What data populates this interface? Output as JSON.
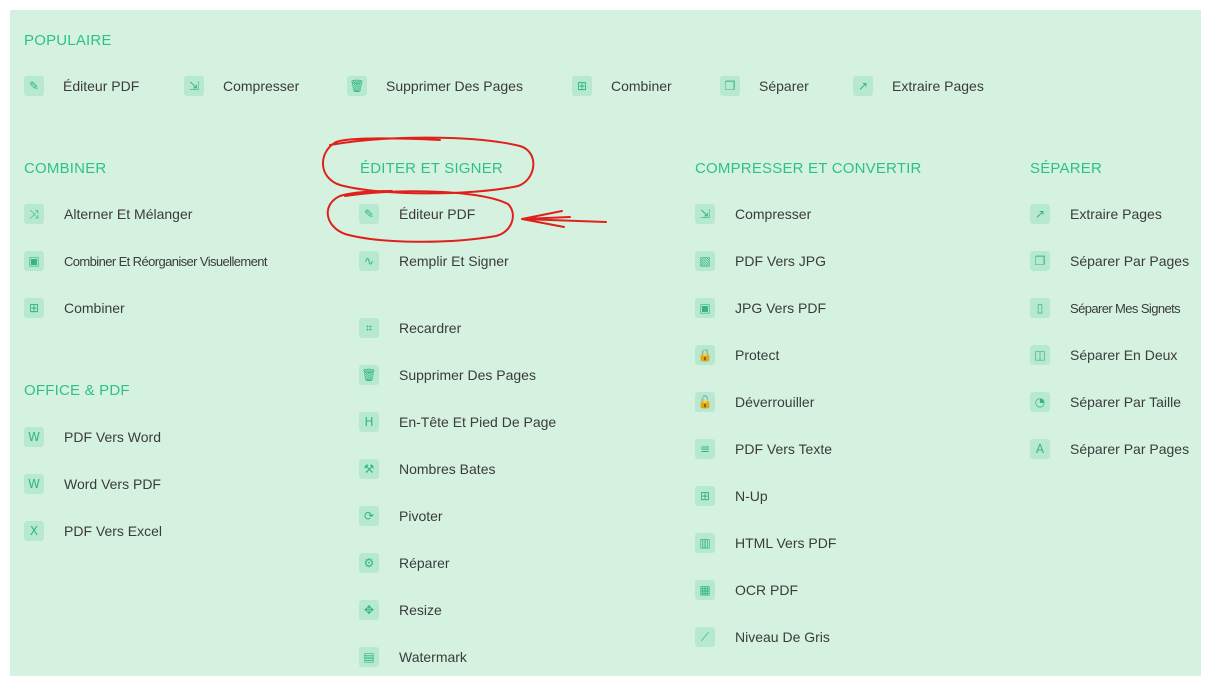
{
  "colors": {
    "panel_bg": "#d5f2e1",
    "accent": "#2fc08a",
    "icon_bg": "#b6e9cf",
    "annotation": "#e0201a"
  },
  "popular": {
    "heading": "POPULAIRE",
    "items": [
      {
        "label": "Éditeur PDF",
        "icon": "pencil-icon"
      },
      {
        "label": "Compresser",
        "icon": "compress-icon"
      },
      {
        "label": "Supprimer Des Pages",
        "icon": "trash-icon"
      },
      {
        "label": "Combiner",
        "icon": "sitemap-icon"
      },
      {
        "label": "Séparer",
        "icon": "copy-icon"
      },
      {
        "label": "Extraire Pages",
        "icon": "external-icon"
      }
    ]
  },
  "combine": {
    "heading": "COMBINER",
    "items": [
      {
        "label": "Alterner Et Mélanger",
        "icon": "shuffle-icon"
      },
      {
        "label": "Combiner Et Réorganiser Visuellement",
        "icon": "image-icon"
      },
      {
        "label": "Combiner",
        "icon": "sitemap-icon"
      }
    ]
  },
  "office": {
    "heading": "OFFICE & PDF",
    "items": [
      {
        "label": "PDF Vers Word",
        "icon": "word-file-icon"
      },
      {
        "label": "Word Vers PDF",
        "icon": "word-file-icon"
      },
      {
        "label": "PDF Vers Excel",
        "icon": "excel-file-icon"
      }
    ]
  },
  "edit": {
    "heading": "ÉDITER ET SIGNER",
    "items": [
      {
        "label": "Éditeur PDF",
        "icon": "pencil-icon"
      },
      {
        "label": "Remplir Et Signer",
        "icon": "signature-icon"
      },
      {
        "label": "Recardrer",
        "icon": "crop-icon"
      },
      {
        "label": "Supprimer Des Pages",
        "icon": "trash-icon"
      },
      {
        "label": "En-Tête Et Pied De Page",
        "icon": "header-icon"
      },
      {
        "label": "Nombres Bates",
        "icon": "stamp-icon"
      },
      {
        "label": "Pivoter",
        "icon": "rotate-icon"
      },
      {
        "label": "Réparer",
        "icon": "wrench-icon"
      },
      {
        "label": "Resize",
        "icon": "move-icon"
      },
      {
        "label": "Watermark",
        "icon": "file-icon"
      }
    ]
  },
  "compress": {
    "heading": "COMPRESSER ET CONVERTIR",
    "items": [
      {
        "label": "Compresser",
        "icon": "compress-icon"
      },
      {
        "label": "PDF Vers JPG",
        "icon": "image-file-icon"
      },
      {
        "label": "JPG Vers PDF",
        "icon": "image-icon"
      },
      {
        "label": "Protect",
        "icon": "lock-icon"
      },
      {
        "label": "Déverrouiller",
        "icon": "unlock-icon"
      },
      {
        "label": "PDF Vers Texte",
        "icon": "text-icon"
      },
      {
        "label": "N-Up",
        "icon": "grid-icon"
      },
      {
        "label": "HTML Vers PDF",
        "icon": "code-file-icon"
      },
      {
        "label": "OCR PDF",
        "icon": "ocr-icon"
      },
      {
        "label": "Niveau De Gris",
        "icon": "brush-icon"
      }
    ]
  },
  "split": {
    "heading": "SÉPARER",
    "items": [
      {
        "label": "Extraire Pages",
        "icon": "external-icon"
      },
      {
        "label": "Séparer Par Pages",
        "icon": "copy-icon"
      },
      {
        "label": "Séparer Mes Signets",
        "icon": "bookmark-icon"
      },
      {
        "label": "Séparer En Deux",
        "icon": "columns-icon"
      },
      {
        "label": "Séparer Par Taille",
        "icon": "pie-icon"
      },
      {
        "label": "Séparer Par Pages",
        "icon": "letter-a-icon"
      }
    ]
  }
}
